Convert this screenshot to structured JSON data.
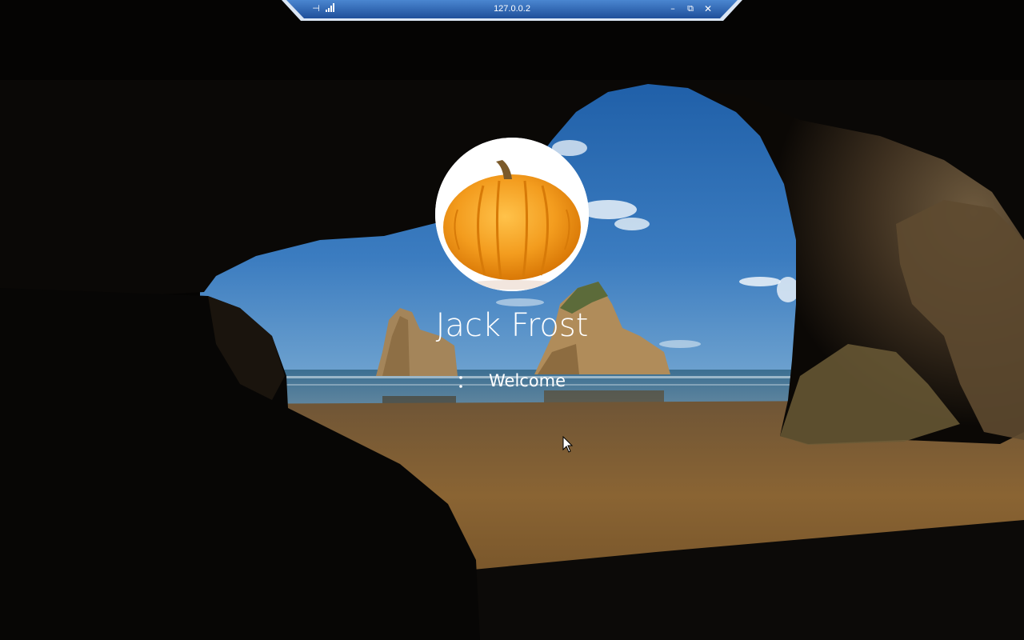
{
  "connection_bar": {
    "title": "127.0.0.2",
    "pin_icon": "pin-icon",
    "signal_icon": "signal-strength-icon",
    "minimize_icon": "minimize-icon",
    "restore_icon": "restore-icon",
    "close_icon": "close-icon",
    "pin_glyph": "⊣",
    "min_glyph": "–",
    "restore_glyph": "⧉",
    "close_glyph": "✕"
  },
  "lock_screen": {
    "user_name": "Jack Frost",
    "status": "Welcome",
    "avatar_icon": "pumpkin-avatar-icon",
    "spinner_icon": "loading-spinner-icon",
    "wallpaper": "sea-cave-beach-wallpaper"
  },
  "colors": {
    "bar_blue": "#2a64b4",
    "bar_light": "#dbe6f4",
    "sky": "#2f6fb3",
    "sand": "#8a6332",
    "rock": "#4a3a24",
    "pumpkin": "#f39c1e"
  }
}
